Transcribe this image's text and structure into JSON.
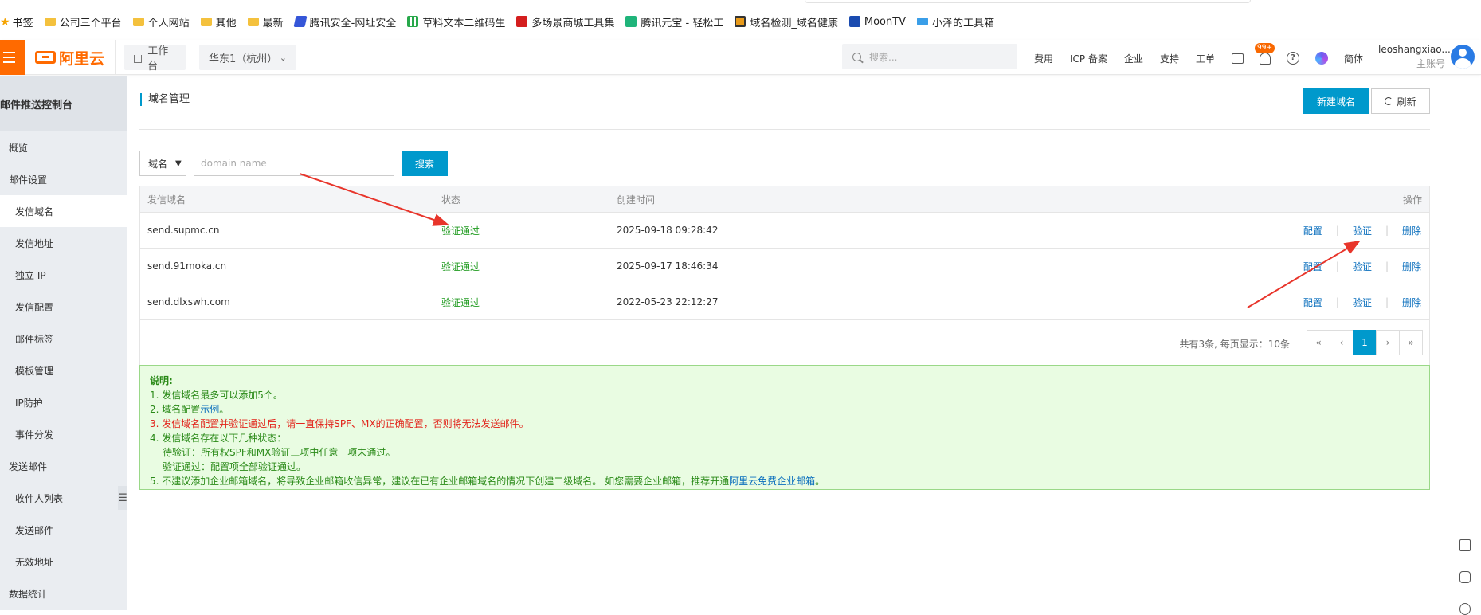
{
  "bookmarks": [
    {
      "label": "书签",
      "icon": "star-icon"
    },
    {
      "label": "公司三个平台",
      "icon": "folder-icon"
    },
    {
      "label": "个人网站",
      "icon": "folder-icon"
    },
    {
      "label": "其他",
      "icon": "folder-icon"
    },
    {
      "label": "最新",
      "icon": "folder-icon"
    },
    {
      "label": "腾讯安全-网址安全",
      "icon": "tencent-security-icon"
    },
    {
      "label": "草料文本二维码生",
      "icon": "qrcode-icon"
    },
    {
      "label": "多场景商城工具集",
      "icon": "duo-icon"
    },
    {
      "label": "腾讯元宝 - 轻松工",
      "icon": "yuanbao-icon"
    },
    {
      "label": "域名检测_域名健康",
      "icon": "domain-check-icon"
    },
    {
      "label": "MoonTV",
      "icon": "moon-icon"
    },
    {
      "label": "小泽的工具箱",
      "icon": "cloud-icon"
    }
  ],
  "topnav": {
    "logo_text": "阿里云",
    "workbench": "工作台",
    "region": "华东1（杭州）",
    "search_placeholder": "搜索...",
    "links": [
      "费用",
      "ICP 备案",
      "企业",
      "支持",
      "工单"
    ],
    "badge": "99+",
    "lang": "简体",
    "user_name": "leoshangxiao...",
    "user_role": "主账号",
    "accent": "#ff6a00"
  },
  "sidebar": {
    "title": "邮件推送控制台",
    "items": [
      {
        "label": "概览",
        "type": "group"
      },
      {
        "label": "邮件设置",
        "type": "group"
      },
      {
        "label": "发信域名",
        "type": "sub",
        "active": true
      },
      {
        "label": "发信地址",
        "type": "sub"
      },
      {
        "label": "独立 IP",
        "type": "sub"
      },
      {
        "label": "发信配置",
        "type": "sub"
      },
      {
        "label": "邮件标签",
        "type": "sub"
      },
      {
        "label": "模板管理",
        "type": "sub"
      },
      {
        "label": "IP防护",
        "type": "sub"
      },
      {
        "label": "事件分发",
        "type": "sub"
      },
      {
        "label": "发送邮件",
        "type": "group"
      },
      {
        "label": "收件人列表",
        "type": "sub"
      },
      {
        "label": "发送邮件",
        "type": "sub"
      },
      {
        "label": "无效地址",
        "type": "sub"
      },
      {
        "label": "数据统计",
        "type": "group"
      }
    ]
  },
  "page": {
    "title": "域名管理",
    "new_domain_button": "新建域名",
    "refresh_button": "刷新",
    "primary_color": "#0099cc"
  },
  "filter": {
    "select_value": "域名",
    "input_placeholder": "domain name",
    "search_button": "搜索"
  },
  "table": {
    "columns": [
      "发信域名",
      "状态",
      "创建时间",
      "操作"
    ],
    "actions": [
      "配置",
      "验证",
      "删除"
    ],
    "rows": [
      {
        "domain": "send.supmc.cn",
        "status": "验证通过",
        "created": "2025-09-18 09:28:42"
      },
      {
        "domain": "send.91moka.cn",
        "status": "验证通过",
        "created": "2025-09-17 18:46:34"
      },
      {
        "domain": "send.dlxswh.com",
        "status": "验证通过",
        "created": "2022-05-23 22:12:27"
      }
    ],
    "status_color": "#1e9a1e"
  },
  "pagination": {
    "info": "共有3条, 每页显示：10条",
    "first": "«",
    "prev": "‹",
    "current": "1",
    "next": "›",
    "last": "»"
  },
  "notes": {
    "title": "说明:",
    "line1": "1. 发信域名最多可以添加5个。",
    "line2_prefix": "2. 域名配置",
    "line2_link": "示例",
    "line2_suffix": "。",
    "line3": "3. 发信域名配置并验证通过后，请一直保持SPF、MX的正确配置，否则将无法发送邮件。",
    "line4": "4. 发信域名存在以下几种状态：",
    "line4a": "待验证：所有权SPF和MX验证三项中任意一项未通过。",
    "line4b": "验证通过：配置项全部验证通过。",
    "line5_prefix": "5. 不建议添加企业邮箱域名，将导致企业邮箱收信异常，建议在已有企业邮箱域名的情况下创建二级域名。 如您需要企业邮箱，推荐开通",
    "line5_link": "阿里云免费企业邮箱",
    "line5_suffix": "。"
  }
}
